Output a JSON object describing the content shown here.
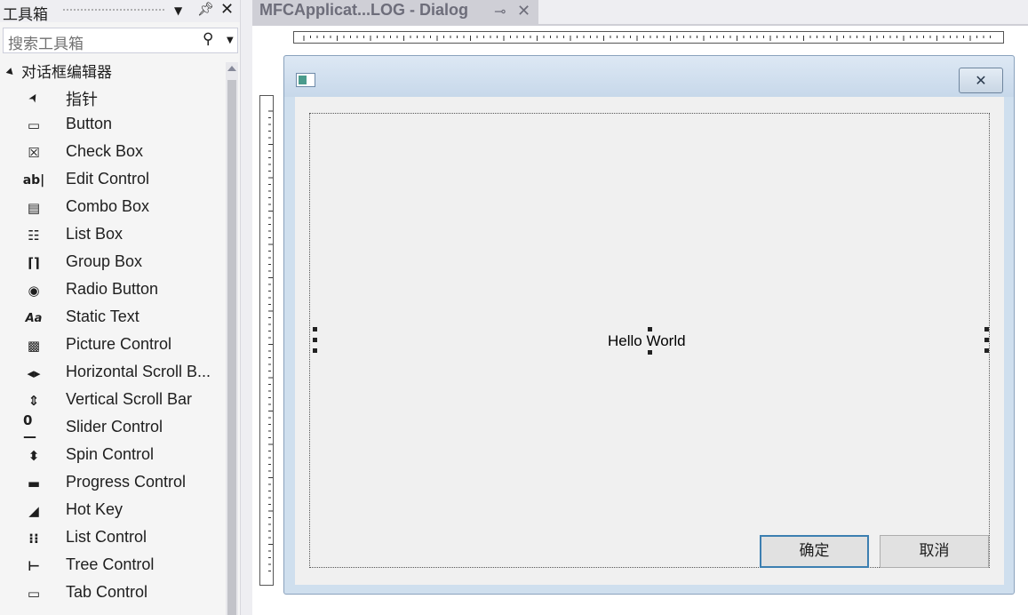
{
  "toolbox": {
    "title": "工具箱",
    "search_placeholder": "搜索工具箱",
    "group_label": "对话框编辑器",
    "items": [
      {
        "label": "指针",
        "icon": "pointer-icon"
      },
      {
        "label": "Button",
        "icon": "button-icon"
      },
      {
        "label": "Check Box",
        "icon": "checkbox-icon"
      },
      {
        "label": "Edit Control",
        "icon": "edit-control-icon"
      },
      {
        "label": "Combo Box",
        "icon": "combo-box-icon"
      },
      {
        "label": "List Box",
        "icon": "list-box-icon"
      },
      {
        "label": "Group Box",
        "icon": "group-box-icon"
      },
      {
        "label": "Radio Button",
        "icon": "radio-button-icon"
      },
      {
        "label": "Static Text",
        "icon": "static-text-icon"
      },
      {
        "label": "Picture Control",
        "icon": "picture-control-icon"
      },
      {
        "label": "Horizontal Scroll B...",
        "icon": "horizontal-scroll-icon"
      },
      {
        "label": "Vertical Scroll Bar",
        "icon": "vertical-scroll-icon"
      },
      {
        "label": "Slider Control",
        "icon": "slider-icon"
      },
      {
        "label": "Spin Control",
        "icon": "spin-icon"
      },
      {
        "label": "Progress Control",
        "icon": "progress-icon"
      },
      {
        "label": "Hot Key",
        "icon": "hot-key-icon"
      },
      {
        "label": "List Control",
        "icon": "list-control-icon"
      },
      {
        "label": "Tree Control",
        "icon": "tree-control-icon"
      },
      {
        "label": "Tab Control",
        "icon": "tab-control-icon"
      }
    ]
  },
  "document_tab": {
    "title": "MFCApplicat...LOG - Dialog"
  },
  "dialog": {
    "static_text": "Hello World",
    "ok_label": "确定",
    "cancel_label": "取消"
  },
  "colors": {
    "dialog_frame": "#cfdfee",
    "ok_border": "#3c7fb1",
    "tab_background": "#cfcfd6"
  }
}
